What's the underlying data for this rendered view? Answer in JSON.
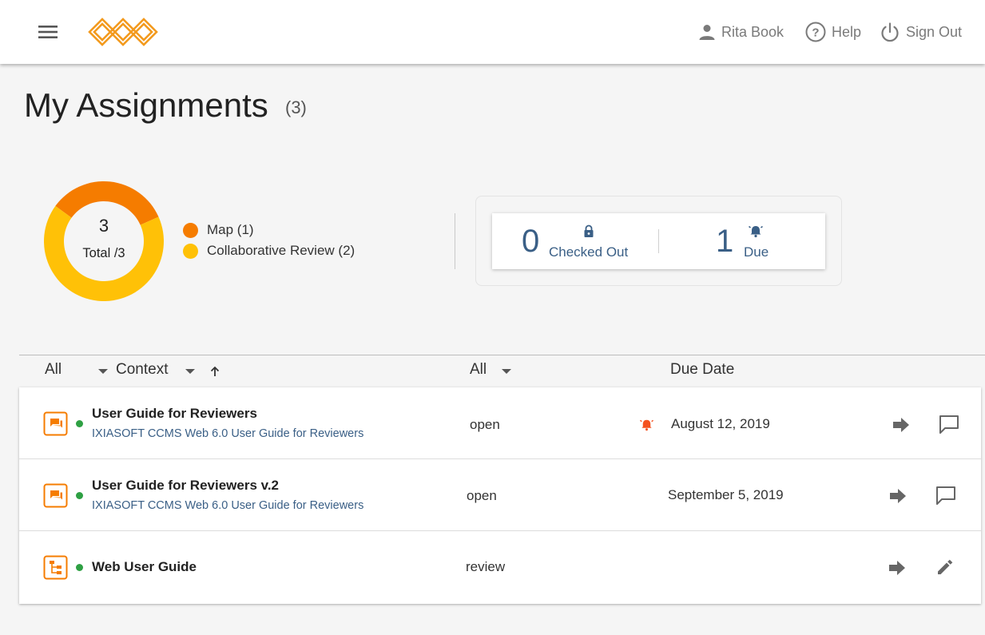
{
  "header": {
    "user_name": "Rita Book",
    "help_label": "Help",
    "signout_label": "Sign Out"
  },
  "page": {
    "title": "My Assignments",
    "count": "(3)"
  },
  "summary": {
    "total": "3",
    "total_label": "Total /3",
    "legend": [
      {
        "label": "Map (1)",
        "color": "#f57c00"
      },
      {
        "label": "Collaborative Review (2)",
        "color": "#ffc107"
      }
    ]
  },
  "chart_data": {
    "type": "pie",
    "categories": [
      "Map",
      "Collaborative Review"
    ],
    "values": [
      1,
      2
    ],
    "colors": [
      "#f57c00",
      "#ffc107"
    ],
    "title": ""
  },
  "stats": {
    "checked_out": {
      "value": "0",
      "label": "Checked Out"
    },
    "due": {
      "value": "1",
      "label": "Due"
    }
  },
  "table": {
    "headers": {
      "type_filter": "All",
      "context": "Context",
      "status_filter": "All",
      "due_date": "Due Date"
    },
    "rows": [
      {
        "title": "User Guide for Reviewers",
        "subtitle": "IXIASOFT CCMS Web 6.0 User Guide for Reviewers",
        "status": "open",
        "due_date": "August 12, 2019",
        "type_icon": "review-icon",
        "overdue": true,
        "action_icon": "comment-icon"
      },
      {
        "title": "User Guide for Reviewers v.2",
        "subtitle": "IXIASOFT CCMS Web 6.0 User Guide for Reviewers",
        "status": "open",
        "due_date": "September 5, 2019",
        "type_icon": "review-icon",
        "overdue": false,
        "action_icon": "comment-icon"
      },
      {
        "title": "Web User Guide",
        "subtitle": "",
        "status": "review",
        "due_date": "",
        "type_icon": "map-icon",
        "overdue": false,
        "action_icon": "pencil-icon"
      }
    ]
  },
  "colors": {
    "accent_orange": "#f57c00",
    "accent_yellow": "#ffc107",
    "link_blue": "#3a5f86",
    "status_green": "#2ea043",
    "alert_red": "#f4511e"
  }
}
